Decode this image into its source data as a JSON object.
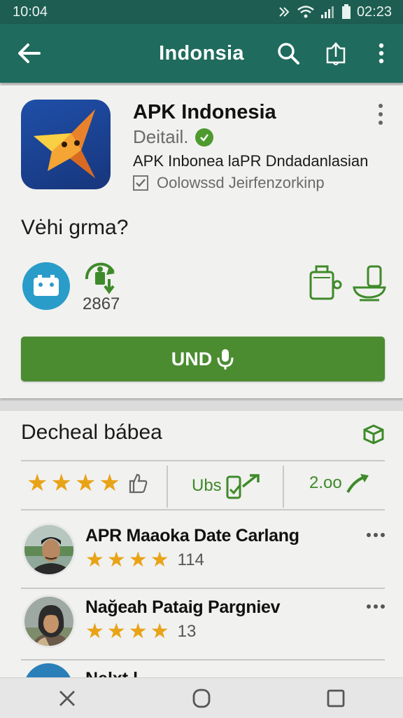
{
  "status_bar": {
    "left_time": "10:04",
    "right_time": "02:23"
  },
  "app_bar": {
    "title": "Indonsia"
  },
  "app": {
    "name": "APK Indonesia",
    "detail_label": "Deitail.",
    "subtitle": "APK Inbonea laPR Dndadanlasian",
    "check_text": "Oolowssd Jeirfenzorkinp"
  },
  "question": "Vėhi grma?",
  "downloads": {
    "count": "2867"
  },
  "install_button": {
    "label": "UND"
  },
  "reviews_section": {
    "title": "Decheal bábea",
    "stat_b_label": "Ubs",
    "stat_c_label": "2.oo",
    "rating_stars": 4
  },
  "reviews": [
    {
      "name": "APR Maaoka Date Carlang",
      "stars": 4,
      "count": "114"
    },
    {
      "name": "Nağeah Pataig Pargniev",
      "stars": 4,
      "count": "13"
    }
  ],
  "peek_review": {
    "name": "Nelxt l ........"
  },
  "colors": {
    "app_bar": "#1f6b5d",
    "accent_green": "#4b8c31",
    "star": "#e8a317"
  },
  "icons": [
    "back-arrow-icon",
    "search-icon",
    "share-icon",
    "overflow-icon",
    "verified-icon",
    "checkbox-icon",
    "store-icon",
    "download-icon",
    "washer-icon",
    "sink-icon",
    "mic-icon",
    "box-icon",
    "thumb-icon",
    "phone-arrow-icon",
    "trend-arrow-icon",
    "close-nav-icon",
    "home-nav-icon",
    "recents-nav-icon"
  ]
}
